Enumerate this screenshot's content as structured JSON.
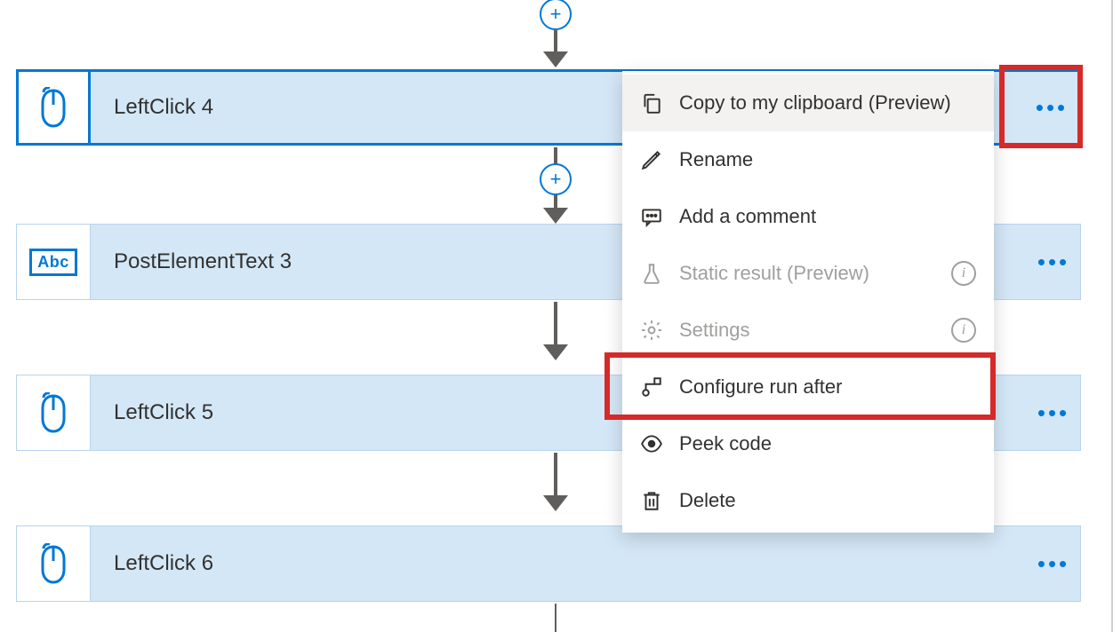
{
  "colors": {
    "accent": "#0078d4",
    "highlight": "#d62929"
  },
  "cards": {
    "c1": {
      "title": "LeftClick 4",
      "icon": "mouse-icon"
    },
    "c2": {
      "title": "PostElementText 3",
      "icon": "abc-icon",
      "icon_text": "Abc"
    },
    "c3": {
      "title": "LeftClick 5",
      "icon": "mouse-icon"
    },
    "c4": {
      "title": "LeftClick 6",
      "icon": "mouse-icon"
    }
  },
  "menu": {
    "copy": {
      "label": "Copy to my clipboard (Preview)"
    },
    "rename": {
      "label": "Rename"
    },
    "comment": {
      "label": "Add a comment"
    },
    "static": {
      "label": "Static result (Preview)"
    },
    "settings": {
      "label": "Settings"
    },
    "runafter": {
      "label": "Configure run after"
    },
    "peek": {
      "label": "Peek code"
    },
    "delete": {
      "label": "Delete"
    }
  },
  "plus_glyph": "+"
}
